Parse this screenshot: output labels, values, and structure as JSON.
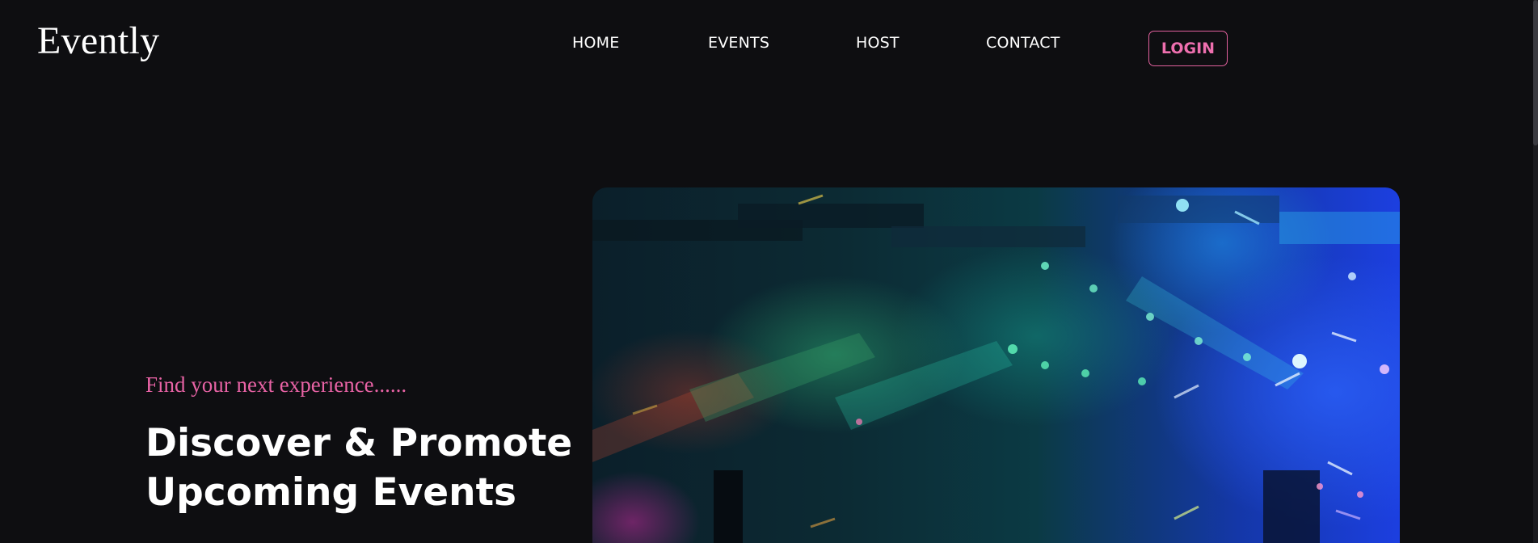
{
  "brand": {
    "logo_text": "Evently"
  },
  "nav": {
    "items": [
      {
        "label": "HOME"
      },
      {
        "label": "EVENTS"
      },
      {
        "label": "HOST"
      },
      {
        "label": "CONTACT"
      }
    ],
    "login_label": "LOGIN"
  },
  "hero": {
    "tagline": "Find your next experience......",
    "headline_line1": "Discover & Promote",
    "headline_line2": "Upcoming Events"
  },
  "colors": {
    "background": "#0e0e11",
    "accent_pink": "#ee6fae",
    "text": "#ffffff"
  }
}
